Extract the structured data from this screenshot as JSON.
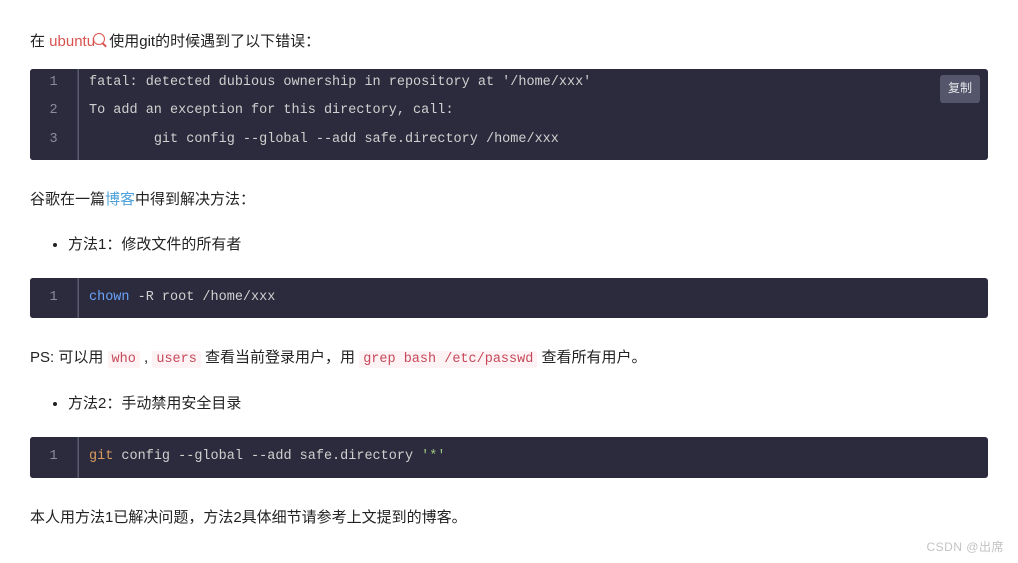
{
  "intro": {
    "prefix": "在 ",
    "tag": "ubuntu",
    "suffix": " 使用git的时候遇到了以下错误："
  },
  "code1": {
    "copy": "复制",
    "lines": [
      "fatal: detected dubious ownership in repository at '/home/xxx'",
      "To add an exception for this directory, call:",
      "\tgit config --global --add safe.directory /home/xxx"
    ]
  },
  "solution_intro": {
    "prefix": "谷歌在一篇",
    "link": "博客",
    "suffix": "中得到解决方法："
  },
  "method1": "方法1：修改文件的所有者",
  "code2": {
    "chown": "chown",
    "rest": " -R root /home/xxx"
  },
  "ps": {
    "prefix": "PS: 可以用 ",
    "who": "who",
    "comma": " , ",
    "users": "users",
    "mid1": " 查看当前登录用户，用 ",
    "grep": "grep bash /etc/passwd",
    "suffix": " 查看所有用户。"
  },
  "method2": "方法2：手动禁用安全目录",
  "code3": {
    "git": "git",
    "mid": " config --global --add safe.directory ",
    "star": "'*'"
  },
  "conclusion": "本人用方法1已解决问题，方法2具体细节请参考上文提到的博客。",
  "watermark": "CSDN @出席"
}
